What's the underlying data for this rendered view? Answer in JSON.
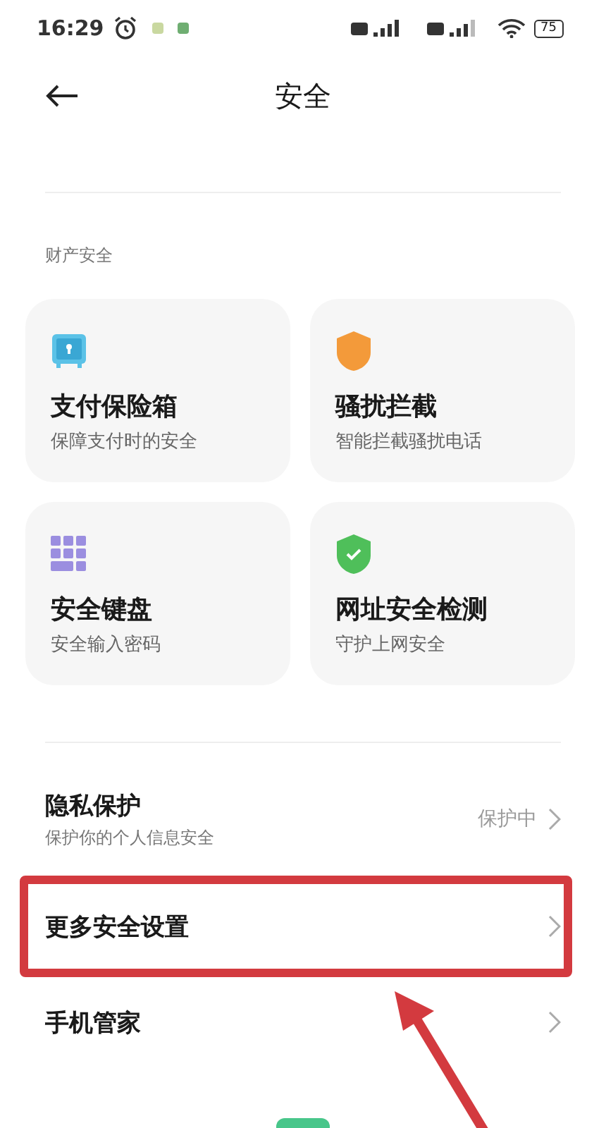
{
  "status_bar": {
    "time": "16:29",
    "battery": "75"
  },
  "header": {
    "title": "安全"
  },
  "section": {
    "label": "财产安全"
  },
  "cards": [
    {
      "kind": "safe",
      "title": "支付保险箱",
      "subtitle": "保障支付时的安全"
    },
    {
      "kind": "shield",
      "title": "骚扰拦截",
      "subtitle": "智能拦截骚扰电话"
    },
    {
      "kind": "keypad",
      "title": "安全键盘",
      "subtitle": "安全输入密码"
    },
    {
      "kind": "shield-check",
      "title": "网址安全检测",
      "subtitle": "守护上网安全"
    }
  ],
  "rows": [
    {
      "title": "隐私保护",
      "subtitle": "保护你的个人信息安全",
      "value": "保护中",
      "highlighted": false
    },
    {
      "title": "更多安全设置",
      "highlighted": true
    },
    {
      "title": "手机管家",
      "highlighted": false
    }
  ]
}
